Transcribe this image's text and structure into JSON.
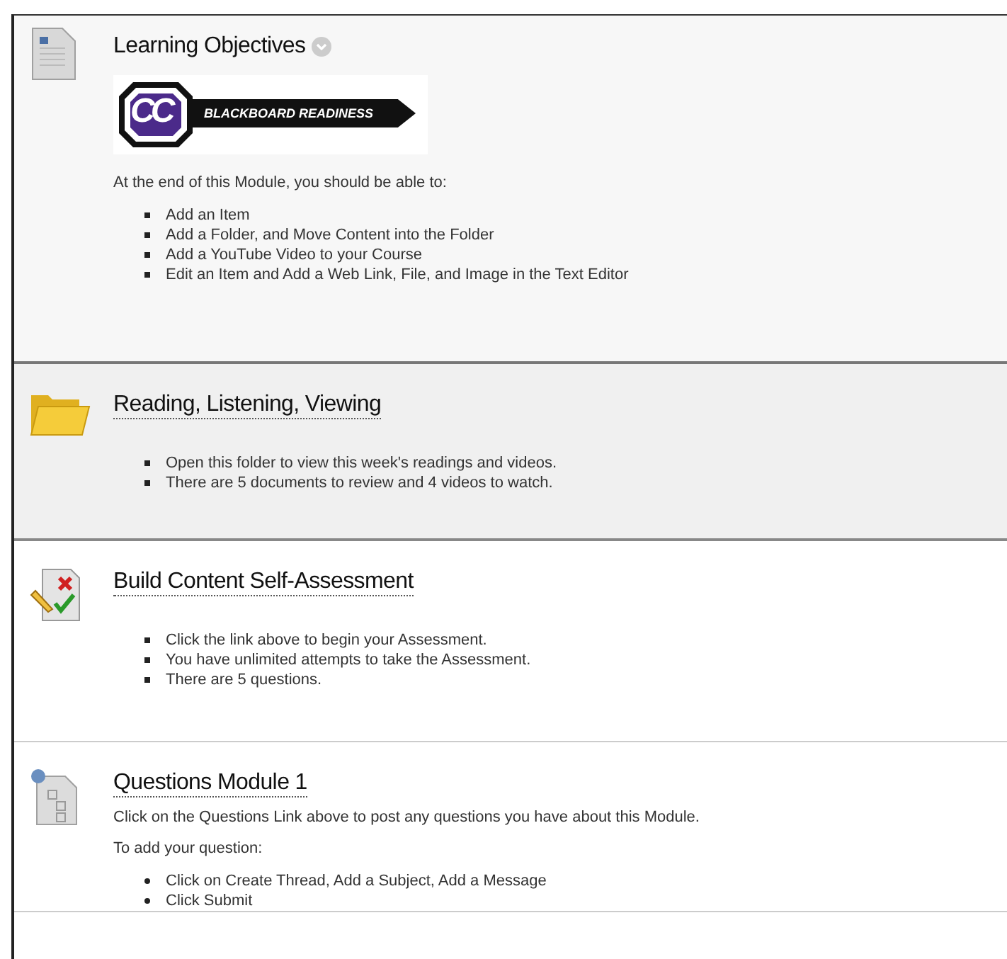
{
  "items": [
    {
      "kind": "document",
      "title": "Learning Objectives",
      "link": false,
      "menu": true,
      "highlighted": false,
      "blocks": [
        {
          "kind": "logo",
          "monogram": "CC",
          "text": "BLACKBOARD READINESS"
        },
        {
          "kind": "paragraph",
          "text": "At the end of this Module, you should be able to:"
        },
        {
          "kind": "square_list",
          "entries": [
            "Add an Item",
            "Add a Folder, and Move Content into the Folder",
            "Add a YouTube Video to your Course",
            "Edit an Item and Add a Web Link, File, and Image in the Text Editor"
          ]
        }
      ]
    },
    {
      "kind": "folder",
      "title": "Reading, Listening, Viewing",
      "link": true,
      "menu": false,
      "highlighted": true,
      "blocks": [
        {
          "kind": "square_list",
          "entries": [
            "Open this folder to view this week's readings and videos.",
            "There are 5 documents to review and 4 videos to watch."
          ]
        }
      ]
    },
    {
      "kind": "assessment",
      "title": "Build Content Self-Assessment",
      "link": true,
      "menu": false,
      "highlighted": false,
      "blocks": [
        {
          "kind": "square_list",
          "entries": [
            "Click the link above to begin your Assessment.",
            "You have unlimited attempts to take the Assessment.",
            "There are 5 questions."
          ]
        }
      ]
    },
    {
      "kind": "discussion",
      "title": "Questions Module 1",
      "link": true,
      "menu": false,
      "highlighted": false,
      "blocks": [
        {
          "kind": "paragraph",
          "text": "Click on the Questions Link above to post any questions you have about this Module."
        },
        {
          "kind": "paragraph",
          "text": "To add your question:"
        },
        {
          "kind": "disc_list",
          "entries": [
            "Click on Create Thread, Add a Subject, Add a Message",
            "Click Submit"
          ]
        }
      ]
    }
  ]
}
